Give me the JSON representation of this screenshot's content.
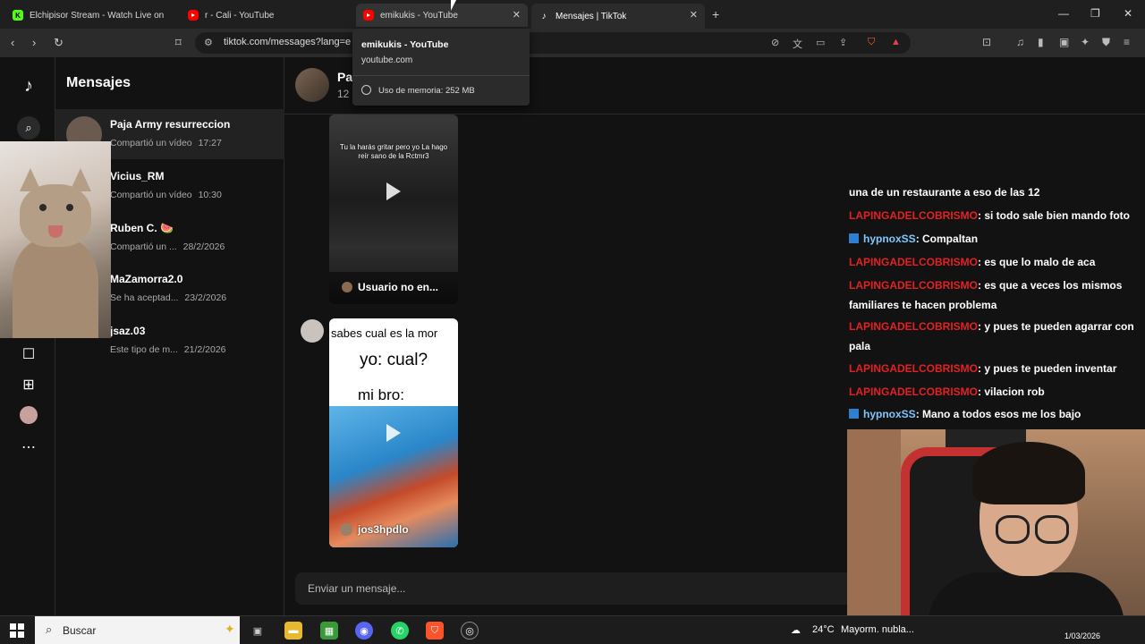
{
  "browser": {
    "tabs": [
      {
        "title": "Elchipisor Stream - Watch Live on",
        "favicon": "kick-icon"
      },
      {
        "title": "r - Cali - YouTube",
        "favicon": "youtube-icon"
      },
      {
        "title": "emikukis - YouTube",
        "favicon": "youtube-icon"
      },
      {
        "title": "Mensajes | TikTok",
        "favicon": "tiktok-icon"
      }
    ],
    "url": "tiktok.com/messages?lang=e",
    "tooltip": {
      "title": "emikukis - YouTube",
      "host": "youtube.com",
      "memory": "Uso de memoria: 252 MB"
    }
  },
  "tiktok": {
    "sidebar_title": "Mensajes",
    "conversations": [
      {
        "name": "Paja Army resurreccion",
        "preview": "Compartió un vídeo",
        "time": "17:27"
      },
      {
        "name": "Vicius_RM",
        "preview": "Compartió un vídeo",
        "time": "10:30"
      },
      {
        "name": "Ruben C. 🍉",
        "preview": "Compartió un ...",
        "time": "28/2/2026"
      },
      {
        "name": "MaZamorra2.0",
        "preview": "Se ha aceptad...",
        "time": "23/2/2026"
      },
      {
        "name": "jsaz.03",
        "preview": "Este tipo de m...",
        "time": "21/2/2026"
      }
    ],
    "chat_header": {
      "name": "Pa",
      "sub": "12"
    },
    "video1": {
      "caption": "Tu la harás gritar pero yo La hago reír sano de la Rctmr3",
      "footer": "Usuario no en..."
    },
    "video2": {
      "line1": "sabes cual es la mor",
      "line2": "yo: cual?",
      "line3": "mi bro:",
      "handle": "jos3hpdlo"
    },
    "composer_placeholder": "Enviar un mensaje..."
  },
  "stream_chat": [
    {
      "user": "",
      "text": "una de un restaurante a eso de las 12"
    },
    {
      "user": "LAPINGADELCOBRISMO",
      "text": ": si todo sale bien mando foto"
    },
    {
      "user": "hypnoxSS",
      "text": ": Compaltan",
      "badge": true
    },
    {
      "user": "LAPINGADELCOBRISMO",
      "text": ": es que lo malo de aca"
    },
    {
      "user": "LAPINGADELCOBRISMO",
      "text": ": es que a veces los mismos familiares te hacen problema"
    },
    {
      "user": "LAPINGADELCOBRISMO",
      "text": ": y pues te pueden agarrar con pala"
    },
    {
      "user": "LAPINGADELCOBRISMO",
      "text": ": y pues te pueden inventar"
    },
    {
      "user": "LAPINGADELCOBRISMO",
      "text": ": vilacion rob"
    },
    {
      "user": "hypnoxSS",
      "text": ": Mano a todos esos me los bajo",
      "badge": true
    }
  ],
  "taskbar": {
    "search_label": "Buscar",
    "weather": "24°C",
    "weather_text": "Mayorm. nubla...",
    "date": "1/03/2026"
  },
  "colors": {
    "chat_user": "#e22222",
    "chat_user_alt": "#7ec8ff",
    "tiktok_bg": "#121212"
  }
}
